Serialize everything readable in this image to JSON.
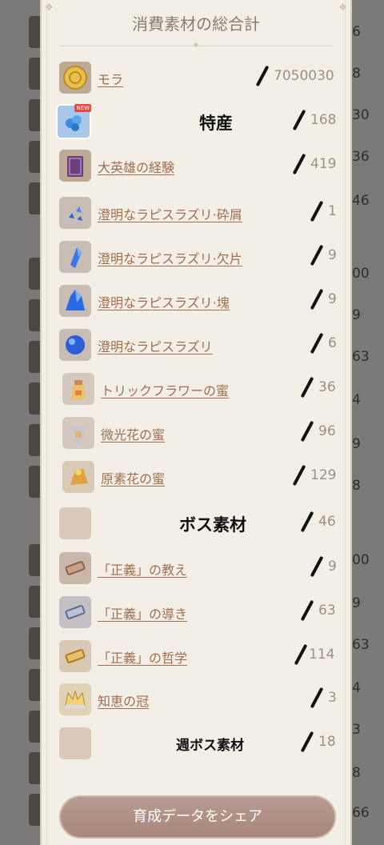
{
  "dialog": {
    "title": "消費素材の総合計",
    "share_button": "育成データをシェア"
  },
  "overlay_labels": {
    "specialty": "特産",
    "boss": "ボス素材",
    "weekly_boss": "週ボス素材"
  },
  "badge_new": "NEW",
  "items": [
    {
      "name": "モラ",
      "count": "7050030",
      "icon": "mora-coin-icon"
    },
    {
      "name": "",
      "count": "168",
      "icon": "specialty-flower-icon"
    },
    {
      "name": "大英雄の経験",
      "count": "419",
      "icon": "exp-book-icon"
    },
    {
      "name": "澄明なラピスラズリ·砕屑",
      "count": "1",
      "icon": "lapis-sliver-icon"
    },
    {
      "name": "澄明なラピスラズリ·欠片",
      "count": "9",
      "icon": "lapis-fragment-icon"
    },
    {
      "name": "澄明なラピスラズリ·塊",
      "count": "9",
      "icon": "lapis-chunk-icon"
    },
    {
      "name": "澄明なラピスラズリ",
      "count": "6",
      "icon": "lapis-gemstone-icon"
    },
    {
      "name": "トリックフラワーの蜜",
      "count": "36",
      "icon": "nectar-bottle-icon"
    },
    {
      "name": "微光花の蜜",
      "count": "96",
      "icon": "shimmering-nectar-icon"
    },
    {
      "name": "原素花の蜜",
      "count": "129",
      "icon": "energy-nectar-icon"
    },
    {
      "name": "",
      "count": "46",
      "icon": "boss-material-icon"
    },
    {
      "name": "「正義」の教え",
      "count": "9",
      "icon": "teachings-scroll-icon"
    },
    {
      "name": "「正義」の導き",
      "count": "63",
      "icon": "guide-scroll-icon"
    },
    {
      "name": "「正義」の哲学",
      "count": "114",
      "icon": "philosophy-scroll-icon"
    },
    {
      "name": "知恵の冠",
      "count": "3",
      "icon": "crown-icon"
    },
    {
      "name": "",
      "count": "18",
      "icon": "weekly-boss-material-icon"
    }
  ],
  "background_counts": [
    "6",
    "8",
    "30",
    "36",
    "46",
    "00",
    "9",
    "63",
    "4",
    "9",
    "8",
    "00",
    "9",
    "63",
    "4",
    "3",
    "8",
    "66"
  ]
}
